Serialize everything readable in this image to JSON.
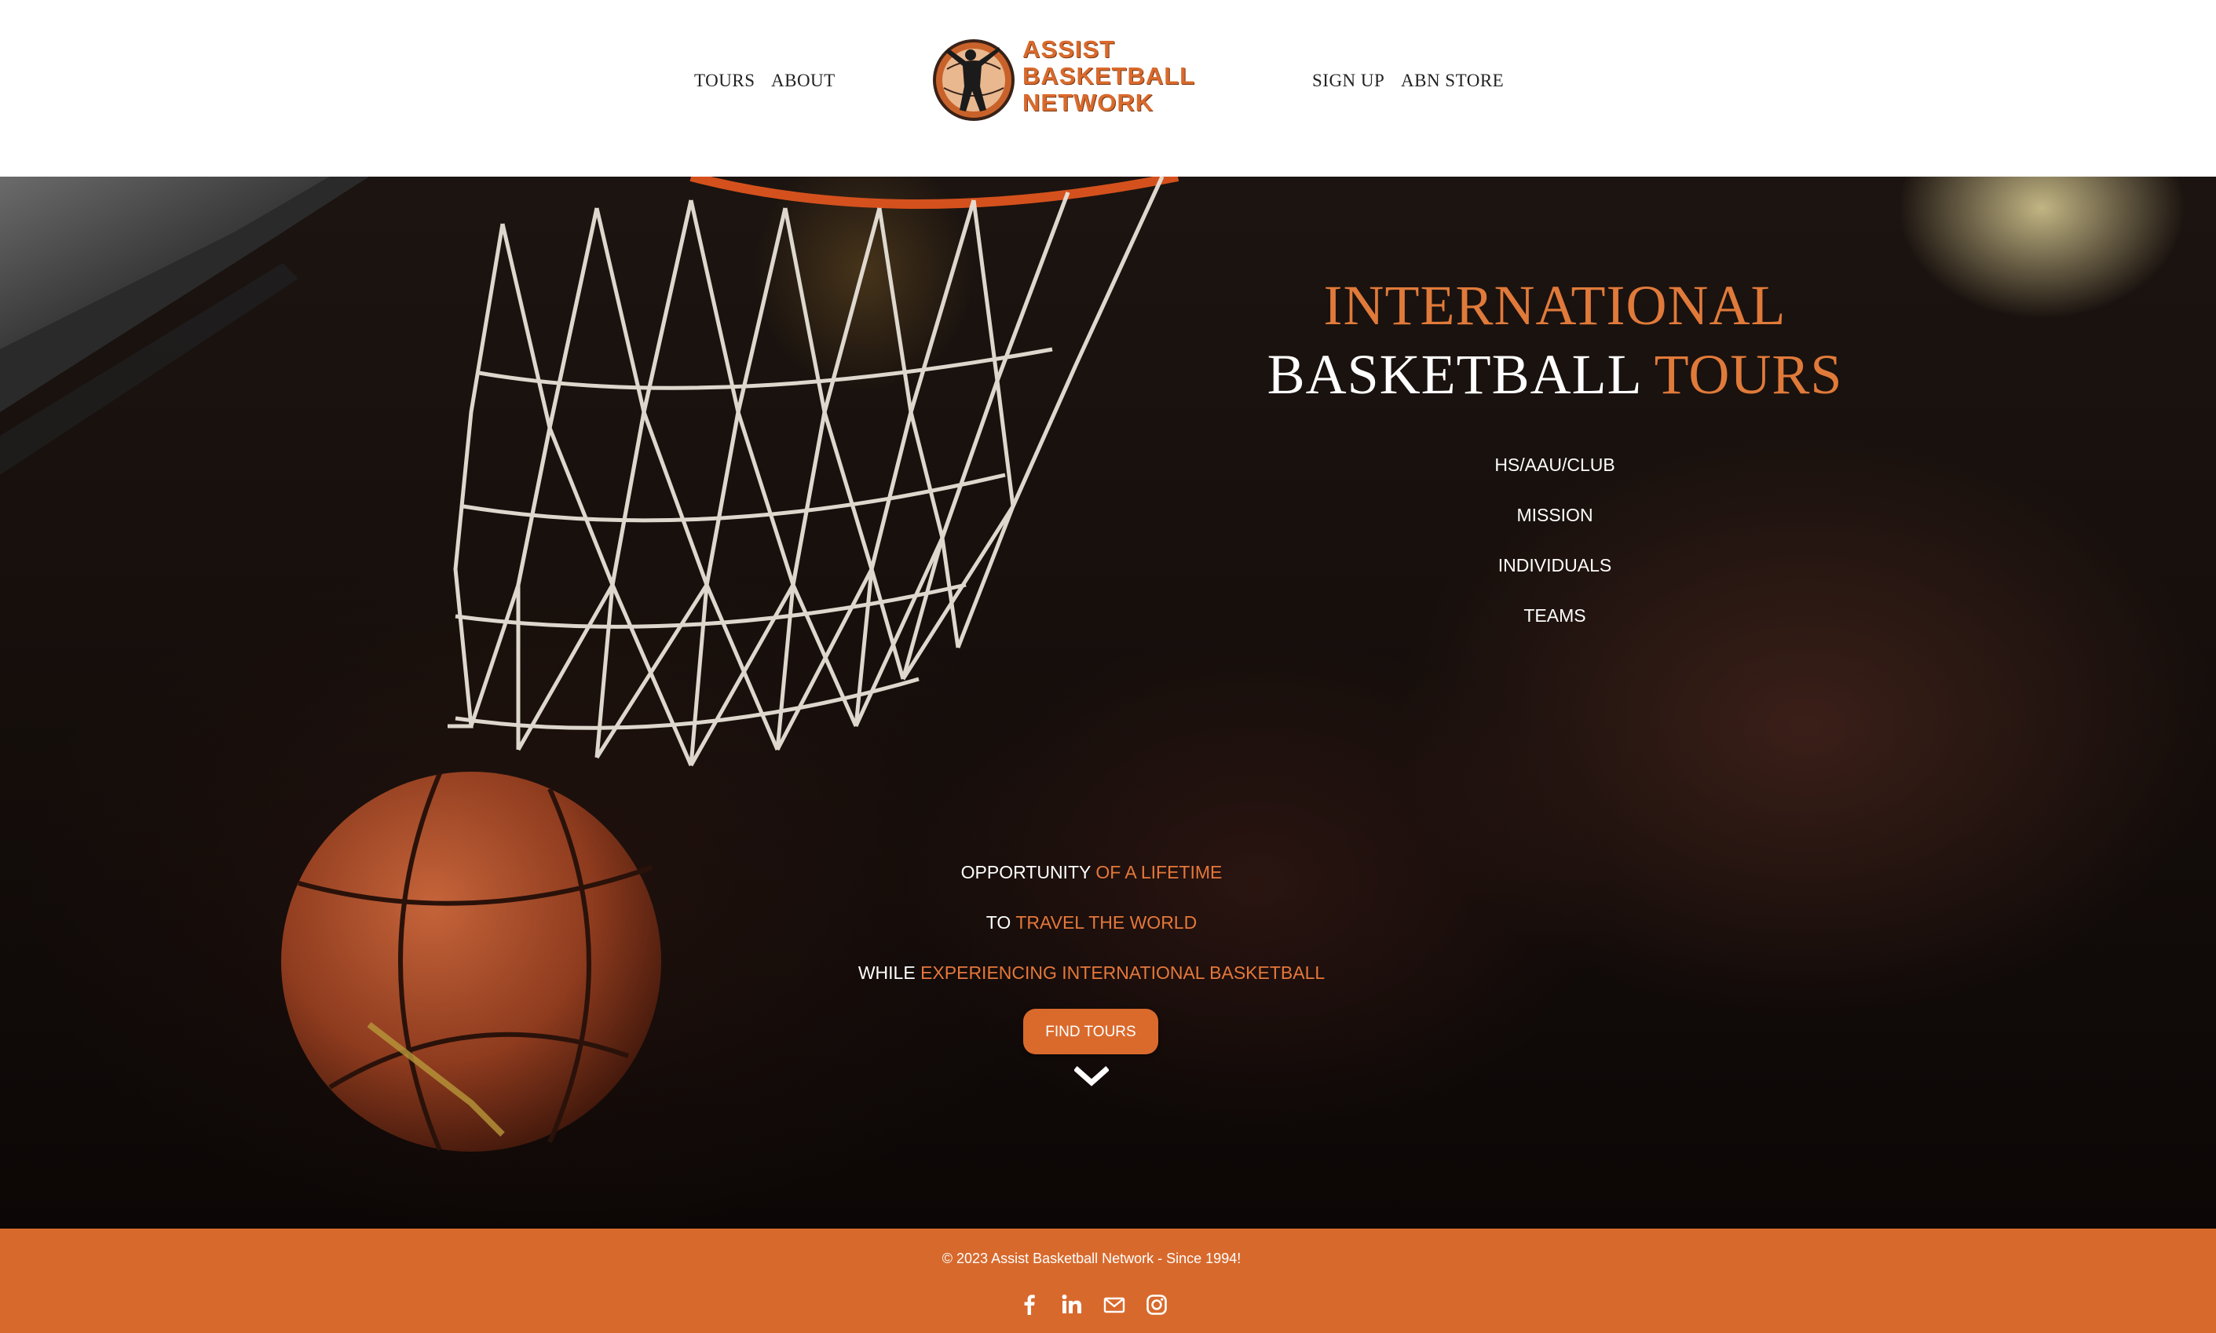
{
  "header": {
    "nav_left": [
      "TOURS",
      "ABOUT"
    ],
    "nav_right": [
      "SIGN UP",
      "ABN STORE"
    ],
    "logo": {
      "lines": [
        "ASSIST",
        "BASKETBALL",
        "NETWORK"
      ]
    }
  },
  "hero": {
    "title_line1": "INTERNATIONAL",
    "title_line2_white": "BASKETBALL",
    "title_line2_orange": "TOURS",
    "links": [
      "HS/AAU/CLUB",
      "MISSION",
      "INDIVIDUALS",
      "TEAMS"
    ],
    "tagline": [
      {
        "white": "OPPORTUNITY",
        "orange": "OF A LIFETIME"
      },
      {
        "white": "TO",
        "orange": "TRAVEL THE WORLD"
      },
      {
        "white": "WHILE",
        "orange": "EXPERIENCING INTERNATIONAL BASKETBALL"
      }
    ],
    "cta_label": "FIND TOURS"
  },
  "footer": {
    "copyright": "© 2023 Assist Basketball Network - Since 1994!",
    "social_icons": [
      "facebook-icon",
      "linkedin-icon",
      "email-icon",
      "instagram-icon"
    ]
  },
  "colors": {
    "accent": "#da6a2c",
    "footer_bg": "#d8692c",
    "hero_orange_text": "#e07a3a"
  }
}
